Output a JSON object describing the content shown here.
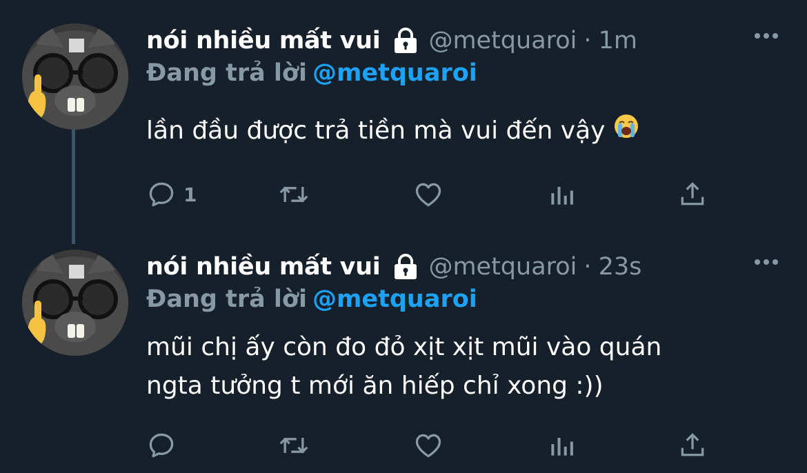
{
  "tweets": [
    {
      "display_name": "nói nhiều mất vui",
      "handle": "@metquaroi",
      "separator": "·",
      "time": "1m",
      "replying_prefix": "Đang trả lời",
      "replying_to": "@metquaroi",
      "text": "lần đầu được trả tiền mà vui đến vậy",
      "emoji": "loudly-crying-face",
      "reply_count": "1"
    },
    {
      "display_name": "nói nhiều mất vui",
      "handle": "@metquaroi",
      "separator": "·",
      "time": "23s",
      "replying_prefix": "Đang trả lời",
      "replying_to": "@metquaroi",
      "text_line1": "mũi chị ấy còn đo đỏ xịt xịt mũi vào quán",
      "text_line2": "ngta tưởng t mới ăn hiếp chỉ xong :))",
      "reply_count": ""
    }
  ],
  "icons": [
    "lock-icon",
    "more-icon",
    "reply-icon",
    "retweet-icon",
    "like-icon",
    "analytics-icon",
    "share-icon"
  ],
  "colors": {
    "background": "#15202b",
    "secondary_text": "#8899a6",
    "mention": "#1da1f2",
    "thread_line": "#3d5466"
  }
}
